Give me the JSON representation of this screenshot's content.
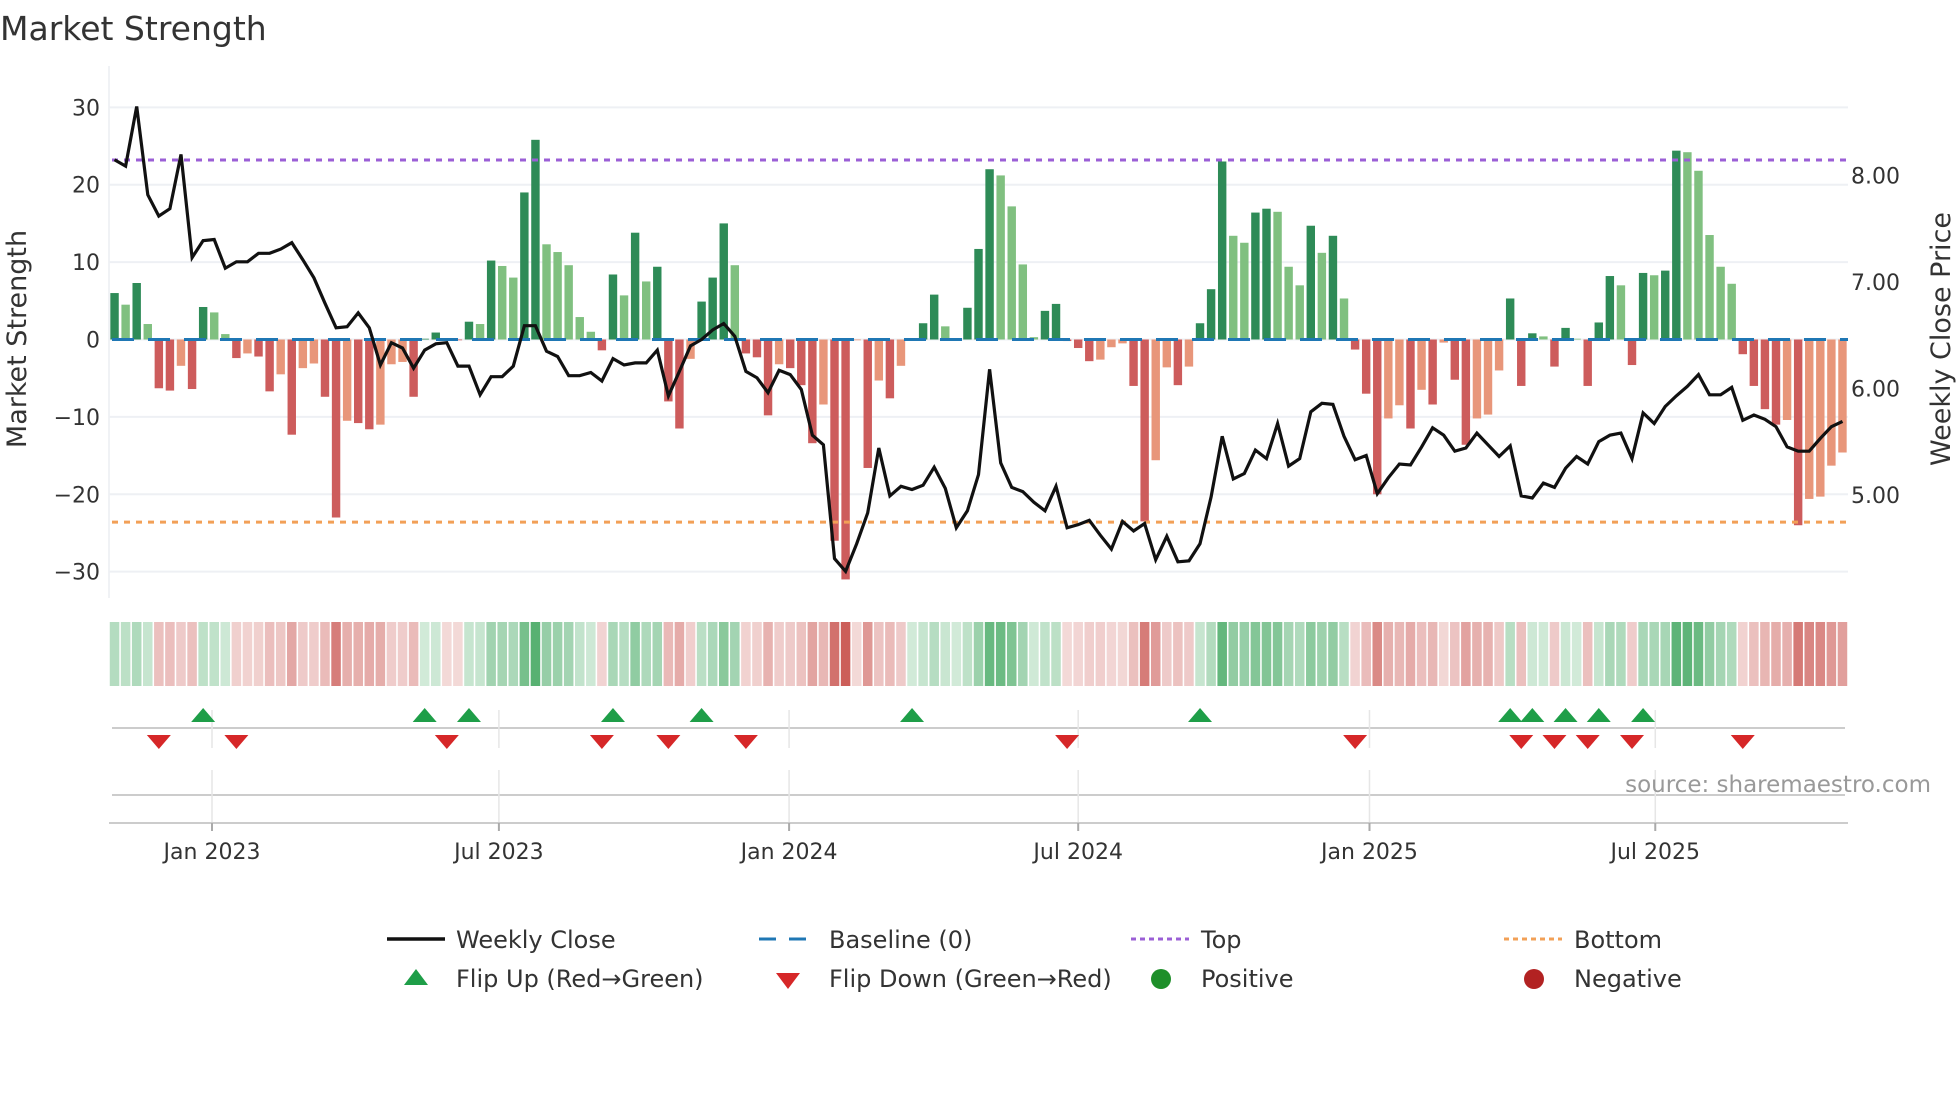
{
  "title": "Market Strength",
  "source": "source: sharemaestro.com",
  "chart_data": {
    "type": "bar+line",
    "title": "Market Strength",
    "ylabel_left": "Market Strength",
    "ylabel_right": "Weekly Close Price",
    "ylim_left": [
      -33.4,
      33.4
    ],
    "ylim_right": [
      4.03,
      8.89
    ],
    "yticks_left": [
      {
        "value": 30,
        "label": "30"
      },
      {
        "value": 20,
        "label": "20"
      },
      {
        "value": 10,
        "label": "10"
      },
      {
        "value": 0,
        "label": "0"
      },
      {
        "value": -10,
        "label": "−10"
      },
      {
        "value": -20,
        "label": "−20"
      },
      {
        "value": -30,
        "label": "−30"
      }
    ],
    "yticks_right": [
      {
        "value": 8,
        "label": "8.00"
      },
      {
        "value": 7,
        "label": "7.00"
      },
      {
        "value": 6,
        "label": "6.00"
      },
      {
        "value": 5,
        "label": "5.00"
      }
    ],
    "x_unit": "week index",
    "xticks": [
      {
        "label": "Jan 2023",
        "week": 8.8
      },
      {
        "label": "Jul 2023",
        "week": 34.7
      },
      {
        "label": "Jan 2024",
        "week": 60.9
      },
      {
        "label": "Jul 2024",
        "week": 87.0
      },
      {
        "label": "Jan 2025",
        "week": 113.3
      },
      {
        "label": "Jul 2025",
        "week": 139.1
      }
    ],
    "top_level": 23.2,
    "bottom_level": -23.6,
    "baseline": 0,
    "strength": [
      6,
      4.5,
      7.3,
      2,
      -6.3,
      -6.6,
      -3.4,
      -6.4,
      4.2,
      3.5,
      0.7,
      -2.4,
      -1.8,
      -2.2,
      -6.7,
      -4.5,
      -12.3,
      -3.7,
      -3.1,
      -7.4,
      -23,
      -10.5,
      -10.8,
      -11.6,
      -11,
      -3.2,
      -2.9,
      -7.4,
      0.1,
      0.9,
      -0.1,
      -0.1,
      2.3,
      2,
      10.2,
      9.5,
      8,
      19,
      25.8,
      12.3,
      11.3,
      9.6,
      2.9,
      1,
      -1.4,
      8.4,
      5.7,
      13.8,
      7.5,
      9.4,
      -8,
      -11.5,
      -2.5,
      4.9,
      8,
      15,
      9.6,
      -1.8,
      -2.3,
      -9.8,
      -3.2,
      -3.7,
      -5.9,
      -13.4,
      -8.4,
      -26,
      -31,
      -0.1,
      -16.6,
      -5.3,
      -7.6,
      -3.4,
      0.1,
      2.1,
      5.8,
      1.7,
      0.1,
      4.1,
      11.7,
      22,
      21.2,
      17.2,
      9.7,
      0.3,
      3.7,
      4.6,
      -0.2,
      -1.1,
      -2.8,
      -2.6,
      -1,
      -0.5,
      -6,
      -23.5,
      -15.6,
      -3.6,
      -5.9,
      -3.5,
      2.1,
      6.5,
      23,
      13.4,
      12.5,
      16.4,
      16.9,
      16.5,
      9.4,
      7,
      14.7,
      11.2,
      13.4,
      5.3,
      -1.3,
      -7,
      -20,
      -10.2,
      -8.5,
      -11.5,
      -6.5,
      -8.4,
      -0.4,
      -5.2,
      -13.6,
      -10.2,
      -9.7,
      -4,
      5.3,
      -6,
      0.8,
      0.4,
      -3.5,
      1.5,
      0.1,
      -6,
      2.2,
      8.2,
      7,
      -3.3,
      8.6,
      8.3,
      8.9,
      24.4,
      24.2,
      21.8,
      13.5,
      9.4,
      7.2,
      -1.9,
      -6,
      -9,
      -11,
      -10.4,
      -24,
      -20.6,
      -20.3,
      -16.3,
      -14.6
    ],
    "close": [
      8.15,
      8.09,
      8.65,
      7.82,
      7.62,
      7.69,
      8.2,
      7.23,
      7.39,
      7.4,
      7.13,
      7.19,
      7.19,
      7.27,
      7.27,
      7.31,
      7.37,
      7.21,
      7.04,
      6.8,
      6.57,
      6.58,
      6.71,
      6.57,
      6.22,
      6.43,
      6.38,
      6.19,
      6.36,
      6.42,
      6.43,
      6.21,
      6.21,
      5.94,
      6.11,
      6.11,
      6.21,
      6.59,
      6.59,
      6.35,
      6.3,
      6.12,
      6.12,
      6.15,
      6.07,
      6.28,
      6.22,
      6.24,
      6.24,
      6.36,
      5.93,
      6.16,
      6.4,
      6.46,
      6.55,
      6.61,
      6.49,
      6.16,
      6.1,
      5.96,
      6.17,
      6.13,
      5.99,
      5.56,
      5.47,
      4.4,
      4.28,
      4.54,
      4.83,
      5.44,
      4.99,
      5.08,
      5.05,
      5.09,
      5.26,
      5.06,
      4.69,
      4.85,
      5.19,
      6.18,
      5.3,
      5.07,
      5.03,
      4.93,
      4.85,
      5.08,
      4.69,
      4.72,
      4.76,
      4.62,
      4.49,
      4.75,
      4.66,
      4.73,
      4.39,
      4.61,
      4.37,
      4.38,
      4.54,
      4.98,
      5.55,
      5.15,
      5.2,
      5.42,
      5.34,
      5.67,
      5.27,
      5.34,
      5.78,
      5.86,
      5.85,
      5.55,
      5.33,
      5.37,
      5.01,
      5.16,
      5.29,
      5.28,
      5.45,
      5.63,
      5.56,
      5.41,
      5.44,
      5.58,
      5.47,
      5.36,
      5.46,
      4.99,
      4.97,
      5.11,
      5.07,
      5.25,
      5.36,
      5.29,
      5.5,
      5.56,
      5.58,
      5.34,
      5.77,
      5.67,
      5.83,
      5.93,
      6.02,
      6.13,
      5.94,
      5.94,
      6.01,
      5.7,
      5.75,
      5.71,
      5.64,
      5.45,
      5.41,
      5.41,
      5.53,
      5.64,
      5.69
    ],
    "flip_up_weeks": [
      8,
      28,
      32,
      45,
      53,
      72,
      98,
      126,
      128,
      131,
      134,
      138
    ],
    "flip_down_weeks": [
      4,
      11,
      30,
      44,
      50,
      57,
      86,
      112,
      127,
      130,
      133,
      137,
      147
    ],
    "legend": {
      "weekly_close": "Weekly Close",
      "baseline": "Baseline (0)",
      "top": "Top",
      "bottom": "Bottom",
      "flip_up": "Flip Up (Red→Green)",
      "flip_down": "Flip Down (Green→Red)",
      "positive": "Positive",
      "negative": "Negative"
    },
    "legend_placement": "bottom",
    "colors": {
      "pos_strong": "#2e8b57",
      "pos_weak": "#80c080",
      "neg_strong": "#cd5c5c",
      "neg_weak": "#e8967a",
      "line": "#111111",
      "baseline": "#1f77b4",
      "top": "#9b5fd6",
      "bottom": "#f2a057",
      "flip_up": "#1e9e48",
      "flip_down": "#d62728",
      "positive_dot": "#1e8f2a",
      "negative_dot": "#b22222"
    }
  }
}
